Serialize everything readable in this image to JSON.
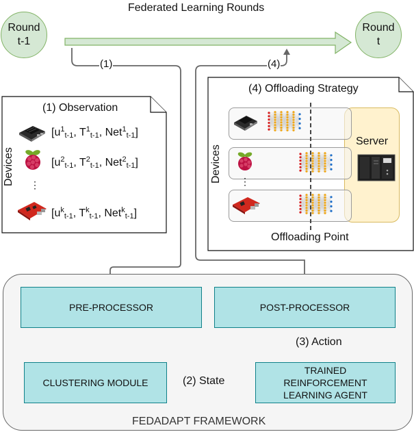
{
  "header": {
    "title": "Federated Learning Rounds"
  },
  "rounds": {
    "previous": "Round\nt-1",
    "next": "Round\nt"
  },
  "edges": {
    "step1": "(1)",
    "step4": "(4)",
    "state": "(2) State",
    "action": "(3) Action"
  },
  "observation_note": {
    "title": "(1) Observation",
    "axis_label": "Devices",
    "ellipsis": "⋮",
    "rows": [
      {
        "device_icon": "jetson-board-icon",
        "index": "1",
        "sub": "t-1"
      },
      {
        "device_icon": "raspberry-pi-icon",
        "index": "2",
        "sub": "t-1"
      },
      {
        "device_icon": "dev-board-icon",
        "index": "k",
        "sub": "t-1"
      }
    ],
    "vars": [
      "u",
      "T",
      "Net"
    ]
  },
  "offloading_note": {
    "title": "(4) Offloading Strategy",
    "axis_label": "Devices",
    "server_label": "Server",
    "point_label": "Offloading Point",
    "ellipsis": "⋮",
    "lanes": [
      {
        "device_icon": "jetson-board-icon"
      },
      {
        "device_icon": "raspberry-pi-icon"
      },
      {
        "device_icon": "dev-board-icon"
      }
    ]
  },
  "framework": {
    "label": "FEDADAPT FRAMEWORK",
    "pre_processor": "PRE-PROCESSOR",
    "post_processor": "POST-PROCESSOR",
    "clustering": "CLUSTERING MODULE",
    "agent": "TRAINED\nREINFORCEMENT\nLEARNING AGENT"
  },
  "colors": {
    "round_fill": "#d5e8d4",
    "round_stroke": "#82b366",
    "module_fill": "#b0e3e6",
    "module_stroke": "#0e8088",
    "server_fill": "#fff2cc",
    "server_stroke": "#d6b656",
    "framework_fill": "#f5f5f5",
    "connector": "#666666"
  }
}
